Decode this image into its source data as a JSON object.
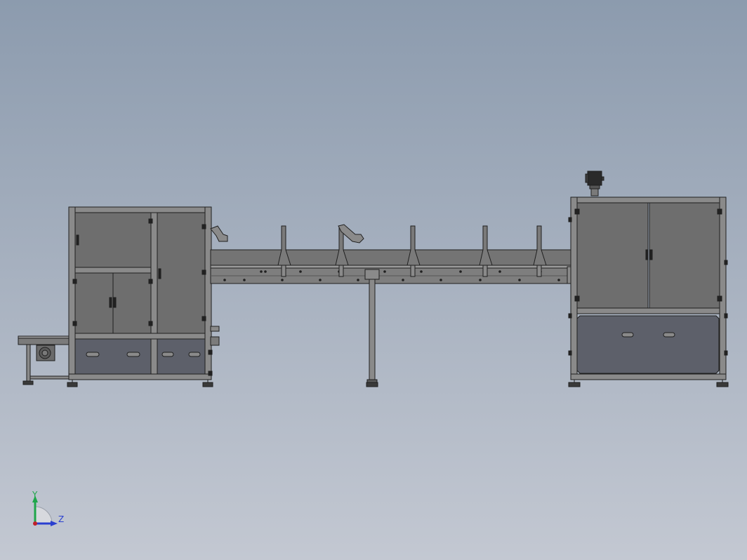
{
  "triad": {
    "y_label": "Y",
    "z_label": "Z",
    "y_color": "#1fa64a",
    "z_color": "#2a3fd0",
    "origin_color": "#c0202a"
  },
  "colors": {
    "bg_top": "#8c9bae",
    "bg_bottom": "#c3c8d2",
    "panel": "#6e6e6e",
    "frame": "#8a8a8a",
    "outline": "#1f1f1f",
    "drawer": "#5d606a"
  }
}
